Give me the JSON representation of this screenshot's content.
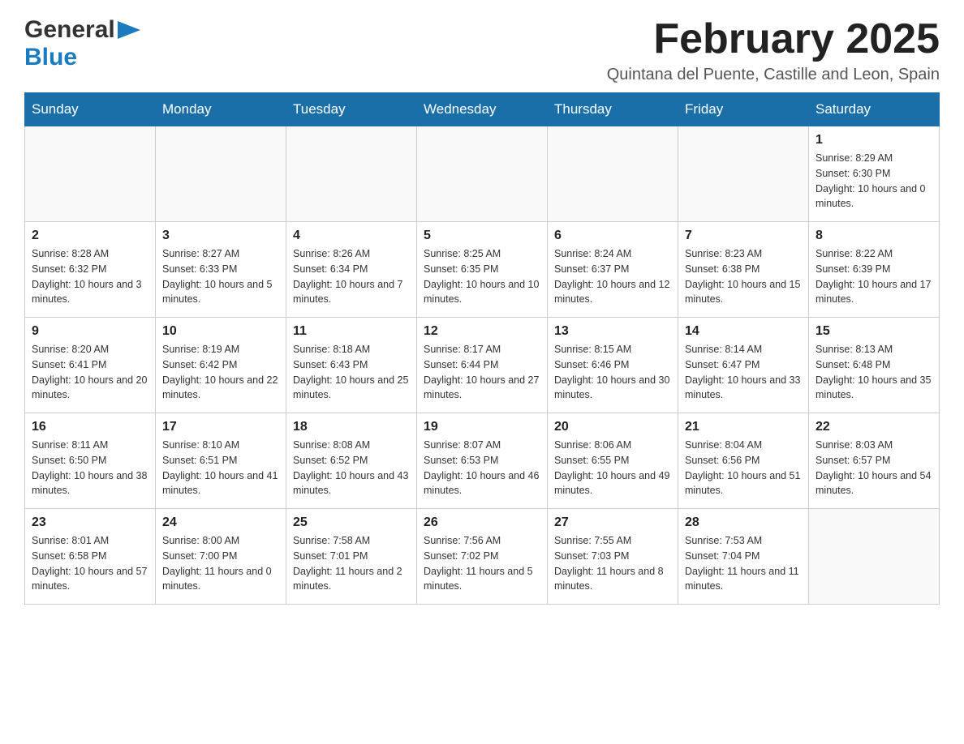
{
  "header": {
    "logo": {
      "general": "General",
      "blue": "Blue",
      "arrow": "▶"
    },
    "title": "February 2025",
    "location": "Quintana del Puente, Castille and Leon, Spain"
  },
  "calendar": {
    "days_of_week": [
      "Sunday",
      "Monday",
      "Tuesday",
      "Wednesday",
      "Thursday",
      "Friday",
      "Saturday"
    ],
    "weeks": [
      [
        {
          "day": "",
          "info": ""
        },
        {
          "day": "",
          "info": ""
        },
        {
          "day": "",
          "info": ""
        },
        {
          "day": "",
          "info": ""
        },
        {
          "day": "",
          "info": ""
        },
        {
          "day": "",
          "info": ""
        },
        {
          "day": "1",
          "info": "Sunrise: 8:29 AM\nSunset: 6:30 PM\nDaylight: 10 hours and 0 minutes."
        }
      ],
      [
        {
          "day": "2",
          "info": "Sunrise: 8:28 AM\nSunset: 6:32 PM\nDaylight: 10 hours and 3 minutes."
        },
        {
          "day": "3",
          "info": "Sunrise: 8:27 AM\nSunset: 6:33 PM\nDaylight: 10 hours and 5 minutes."
        },
        {
          "day": "4",
          "info": "Sunrise: 8:26 AM\nSunset: 6:34 PM\nDaylight: 10 hours and 7 minutes."
        },
        {
          "day": "5",
          "info": "Sunrise: 8:25 AM\nSunset: 6:35 PM\nDaylight: 10 hours and 10 minutes."
        },
        {
          "day": "6",
          "info": "Sunrise: 8:24 AM\nSunset: 6:37 PM\nDaylight: 10 hours and 12 minutes."
        },
        {
          "day": "7",
          "info": "Sunrise: 8:23 AM\nSunset: 6:38 PM\nDaylight: 10 hours and 15 minutes."
        },
        {
          "day": "8",
          "info": "Sunrise: 8:22 AM\nSunset: 6:39 PM\nDaylight: 10 hours and 17 minutes."
        }
      ],
      [
        {
          "day": "9",
          "info": "Sunrise: 8:20 AM\nSunset: 6:41 PM\nDaylight: 10 hours and 20 minutes."
        },
        {
          "day": "10",
          "info": "Sunrise: 8:19 AM\nSunset: 6:42 PM\nDaylight: 10 hours and 22 minutes."
        },
        {
          "day": "11",
          "info": "Sunrise: 8:18 AM\nSunset: 6:43 PM\nDaylight: 10 hours and 25 minutes."
        },
        {
          "day": "12",
          "info": "Sunrise: 8:17 AM\nSunset: 6:44 PM\nDaylight: 10 hours and 27 minutes."
        },
        {
          "day": "13",
          "info": "Sunrise: 8:15 AM\nSunset: 6:46 PM\nDaylight: 10 hours and 30 minutes."
        },
        {
          "day": "14",
          "info": "Sunrise: 8:14 AM\nSunset: 6:47 PM\nDaylight: 10 hours and 33 minutes."
        },
        {
          "day": "15",
          "info": "Sunrise: 8:13 AM\nSunset: 6:48 PM\nDaylight: 10 hours and 35 minutes."
        }
      ],
      [
        {
          "day": "16",
          "info": "Sunrise: 8:11 AM\nSunset: 6:50 PM\nDaylight: 10 hours and 38 minutes."
        },
        {
          "day": "17",
          "info": "Sunrise: 8:10 AM\nSunset: 6:51 PM\nDaylight: 10 hours and 41 minutes."
        },
        {
          "day": "18",
          "info": "Sunrise: 8:08 AM\nSunset: 6:52 PM\nDaylight: 10 hours and 43 minutes."
        },
        {
          "day": "19",
          "info": "Sunrise: 8:07 AM\nSunset: 6:53 PM\nDaylight: 10 hours and 46 minutes."
        },
        {
          "day": "20",
          "info": "Sunrise: 8:06 AM\nSunset: 6:55 PM\nDaylight: 10 hours and 49 minutes."
        },
        {
          "day": "21",
          "info": "Sunrise: 8:04 AM\nSunset: 6:56 PM\nDaylight: 10 hours and 51 minutes."
        },
        {
          "day": "22",
          "info": "Sunrise: 8:03 AM\nSunset: 6:57 PM\nDaylight: 10 hours and 54 minutes."
        }
      ],
      [
        {
          "day": "23",
          "info": "Sunrise: 8:01 AM\nSunset: 6:58 PM\nDaylight: 10 hours and 57 minutes."
        },
        {
          "day": "24",
          "info": "Sunrise: 8:00 AM\nSunset: 7:00 PM\nDaylight: 11 hours and 0 minutes."
        },
        {
          "day": "25",
          "info": "Sunrise: 7:58 AM\nSunset: 7:01 PM\nDaylight: 11 hours and 2 minutes."
        },
        {
          "day": "26",
          "info": "Sunrise: 7:56 AM\nSunset: 7:02 PM\nDaylight: 11 hours and 5 minutes."
        },
        {
          "day": "27",
          "info": "Sunrise: 7:55 AM\nSunset: 7:03 PM\nDaylight: 11 hours and 8 minutes."
        },
        {
          "day": "28",
          "info": "Sunrise: 7:53 AM\nSunset: 7:04 PM\nDaylight: 11 hours and 11 minutes."
        },
        {
          "day": "",
          "info": ""
        }
      ]
    ]
  }
}
